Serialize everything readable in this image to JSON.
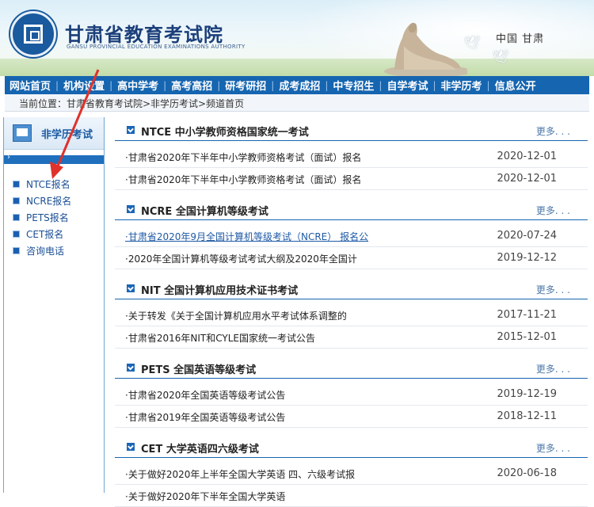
{
  "header": {
    "title": "甘肃省教育考试院",
    "subtitle": "GANSU PROVINCIAL EDUCATION EXAMINATIONS AUTHORITY",
    "region": "中国 甘肃"
  },
  "nav": {
    "items": [
      "网站首页",
      "机构设置",
      "高中学考",
      "高考高招",
      "研考研招",
      "成考成招",
      "中专招生",
      "自学考试",
      "非学历考",
      "信息公开"
    ],
    "separator": "|"
  },
  "breadcrumb": {
    "label": "当前位置：甘肃省教育考试院>非学历考试>频道首页"
  },
  "sidebar": {
    "title": "非学历考试",
    "items": [
      "NTCE报名",
      "NCRE报名",
      "PETS报名",
      "CET报名",
      "咨询电话"
    ]
  },
  "sections": [
    {
      "title": "NTCE 中小学教师资格国家统一考试",
      "more": "更多. . .",
      "rows": [
        {
          "title": "·甘肃省2020年下半年中小学教师资格考试（面试）报名",
          "date": "2020-12-01"
        },
        {
          "title": "·甘肃省2020年下半年中小学教师资格考试（面试）报名",
          "date": "2020-12-01"
        }
      ]
    },
    {
      "title": "NCRE 全国计算机等级考试",
      "more": "更多. . .",
      "rows": [
        {
          "title": "·甘肃省2020年9月全国计算机等级考试（NCRE） 报名公",
          "date": "2020-07-24"
        },
        {
          "title": "·2020年全国计算机等级考试考试大纲及2020年全国计",
          "date": "2019-12-12"
        }
      ]
    },
    {
      "title": "NIT 全国计算机应用技术证书考试",
      "more": "更多. . .",
      "rows": [
        {
          "title": "·关于转发《关于全国计算机应用水平考试体系调整的",
          "date": "2017-11-21"
        },
        {
          "title": "·甘肃省2016年NIT和CYLE国家统一考试公告",
          "date": "2015-12-01"
        }
      ]
    },
    {
      "title": "PETS 全国英语等级考试",
      "more": "更多. . .",
      "rows": [
        {
          "title": "·甘肃省2020年全国英语等级考试公告",
          "date": "2019-12-19"
        },
        {
          "title": "·甘肃省2019年全国英语等级考试公告",
          "date": "2018-12-11"
        }
      ]
    },
    {
      "title": "CET 大学英语四六级考试",
      "more": "更多. . .",
      "rows": [
        {
          "title": "·关于做好2020年上半年全国大学英语 四、六级考试报",
          "date": "2020-06-18"
        },
        {
          "title": "·关于做好2020年下半年全国大学英语",
          "date": ""
        }
      ]
    }
  ],
  "colors": {
    "nav_bg": "#1565b0",
    "accent": "#1a66b8",
    "annotation_arrow": "#e0312a"
  },
  "icons": {
    "logo": "emblem-icon",
    "sidebar": "book-icon",
    "section": "checkbox-icon",
    "list": "square-bullet-icon"
  }
}
